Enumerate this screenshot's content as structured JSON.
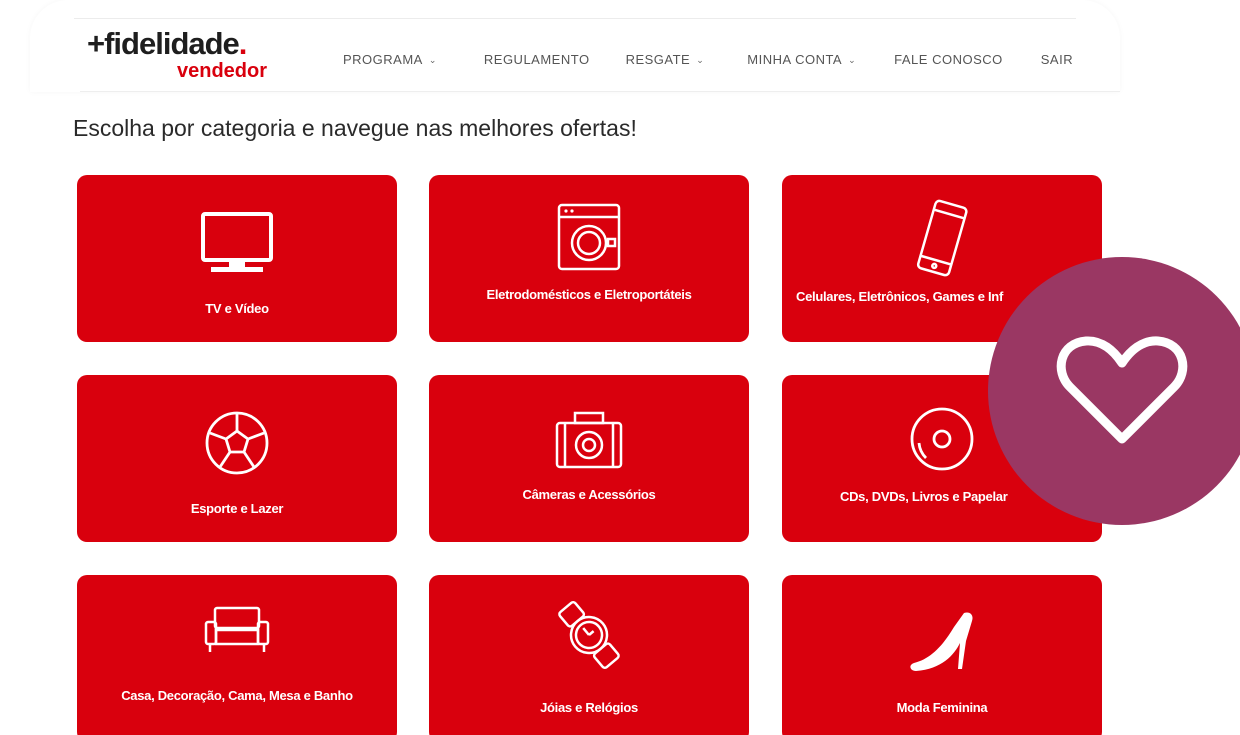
{
  "brand": {
    "name": "+fidelidade",
    "dot": ".",
    "sub": "vendedor",
    "accent": "#d9000d"
  },
  "nav": [
    {
      "label": "PROGRAMA",
      "has_menu": true
    },
    {
      "label": "REGULAMENTO",
      "has_menu": false
    },
    {
      "label": "RESGATE",
      "has_menu": true
    },
    {
      "label": "MINHA CONTA",
      "has_menu": true
    },
    {
      "label": "FALE CONOSCO",
      "has_menu": false
    },
    {
      "label": "SAIR",
      "has_menu": false
    }
  ],
  "headline": "Escolha por categoria e navegue nas melhores ofertas!",
  "categories": [
    {
      "label": "TV e Vídeo",
      "icon": "tv-icon"
    },
    {
      "label": "Eletrodomésticos e Eletroportáteis",
      "icon": "washing-machine-icon"
    },
    {
      "label": "Celulares, Eletrônicos, Games e Inf",
      "icon": "smartphone-icon"
    },
    {
      "label": "Esporte e Lazer",
      "icon": "soccer-ball-icon"
    },
    {
      "label": "Câmeras e Acessórios",
      "icon": "camera-icon"
    },
    {
      "label": "CDs, DVDs, Livros e Papelar",
      "icon": "disc-icon"
    },
    {
      "label": "Casa, Decoração, Cama, Mesa e Banho",
      "icon": "sofa-icon"
    },
    {
      "label": "Jóias e Relógios",
      "icon": "watch-icon"
    },
    {
      "label": "Moda Feminina",
      "icon": "high-heel-icon"
    }
  ],
  "favorite_badge": {
    "icon": "heart-icon",
    "color": "#9a3763"
  }
}
